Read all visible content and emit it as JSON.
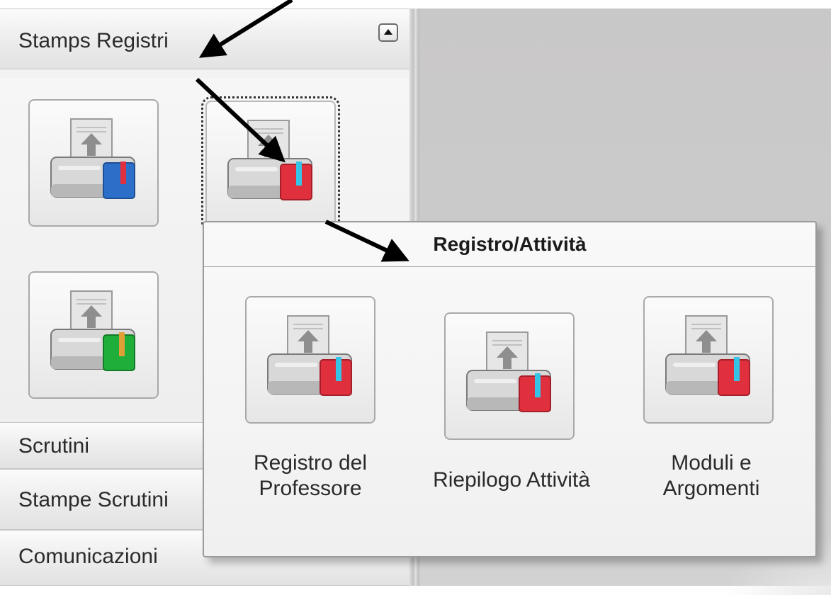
{
  "sidebar": {
    "sections": [
      {
        "title": "Stamps Registri"
      },
      {
        "title": "Scrutini"
      },
      {
        "title": "Stampe Scrutini"
      },
      {
        "title": "Comunicazioni"
      }
    ],
    "tiles": [
      {
        "icon": "printer-blue-book-icon",
        "accent": "#2c6fc9"
      },
      {
        "icon": "printer-red-book-icon",
        "accent": "#e0303e"
      },
      {
        "icon": "printer-green-book-icon",
        "accent": "#1fae3a"
      }
    ]
  },
  "popup": {
    "title": "Registro/Attività",
    "items": [
      {
        "label": "Registro del Professore",
        "icon": "printer-red-book-icon"
      },
      {
        "label": "Riepilogo Attività",
        "icon": "printer-red-book-icon"
      },
      {
        "label": "Moduli e Argomenti",
        "icon": "printer-red-book-icon"
      }
    ]
  }
}
